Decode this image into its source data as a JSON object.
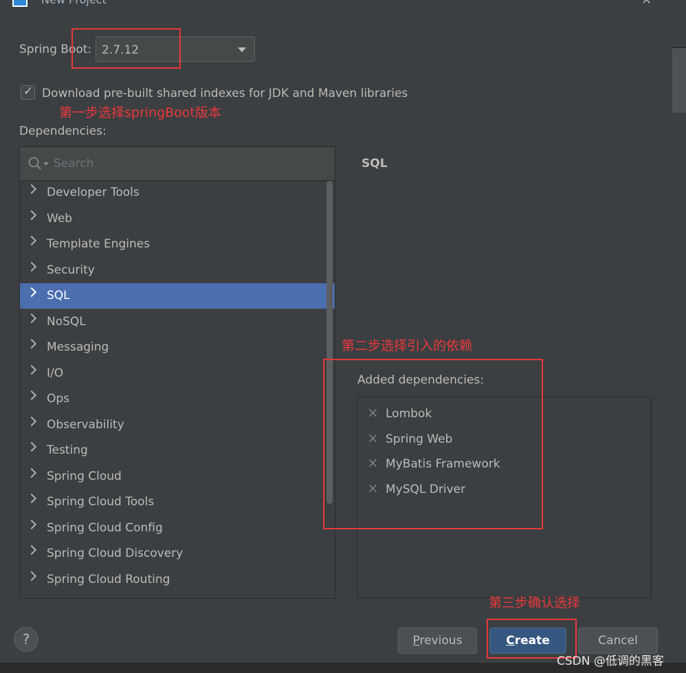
{
  "window": {
    "title": "New Project"
  },
  "spring_boot": {
    "label": "Spring Boot:",
    "version": "2.7.12"
  },
  "download_indexes": {
    "label": "Download pre-built shared indexes for JDK and Maven libraries",
    "checked": true
  },
  "dependencies": {
    "label": "Dependencies:",
    "search_placeholder": "Search",
    "categories": [
      "Developer Tools",
      "Web",
      "Template Engines",
      "Security",
      "SQL",
      "NoSQL",
      "Messaging",
      "I/O",
      "Ops",
      "Observability",
      "Testing",
      "Spring Cloud",
      "Spring Cloud Tools",
      "Spring Cloud Config",
      "Spring Cloud Discovery",
      "Spring Cloud Routing"
    ],
    "selected_category": "SQL"
  },
  "category_panel": {
    "title": "SQL"
  },
  "added": {
    "label": "Added dependencies:",
    "items": [
      "Lombok",
      "Spring Web",
      "MyBatis Framework",
      "MySQL Driver"
    ]
  },
  "annotations": {
    "step1": "第一步选择springBoot版本",
    "step2": "第二步选择引入的依赖",
    "step3": "第三步确认选择",
    "color": "#e8383d"
  },
  "buttons": {
    "help": "?",
    "previous": "Previous",
    "create": "Create",
    "cancel": "Cancel"
  },
  "watermark": "CSDN @低调的黑客",
  "colors": {
    "background": "#3c3f41",
    "selection": "#4b6eaf",
    "primary_button": "#365880"
  }
}
